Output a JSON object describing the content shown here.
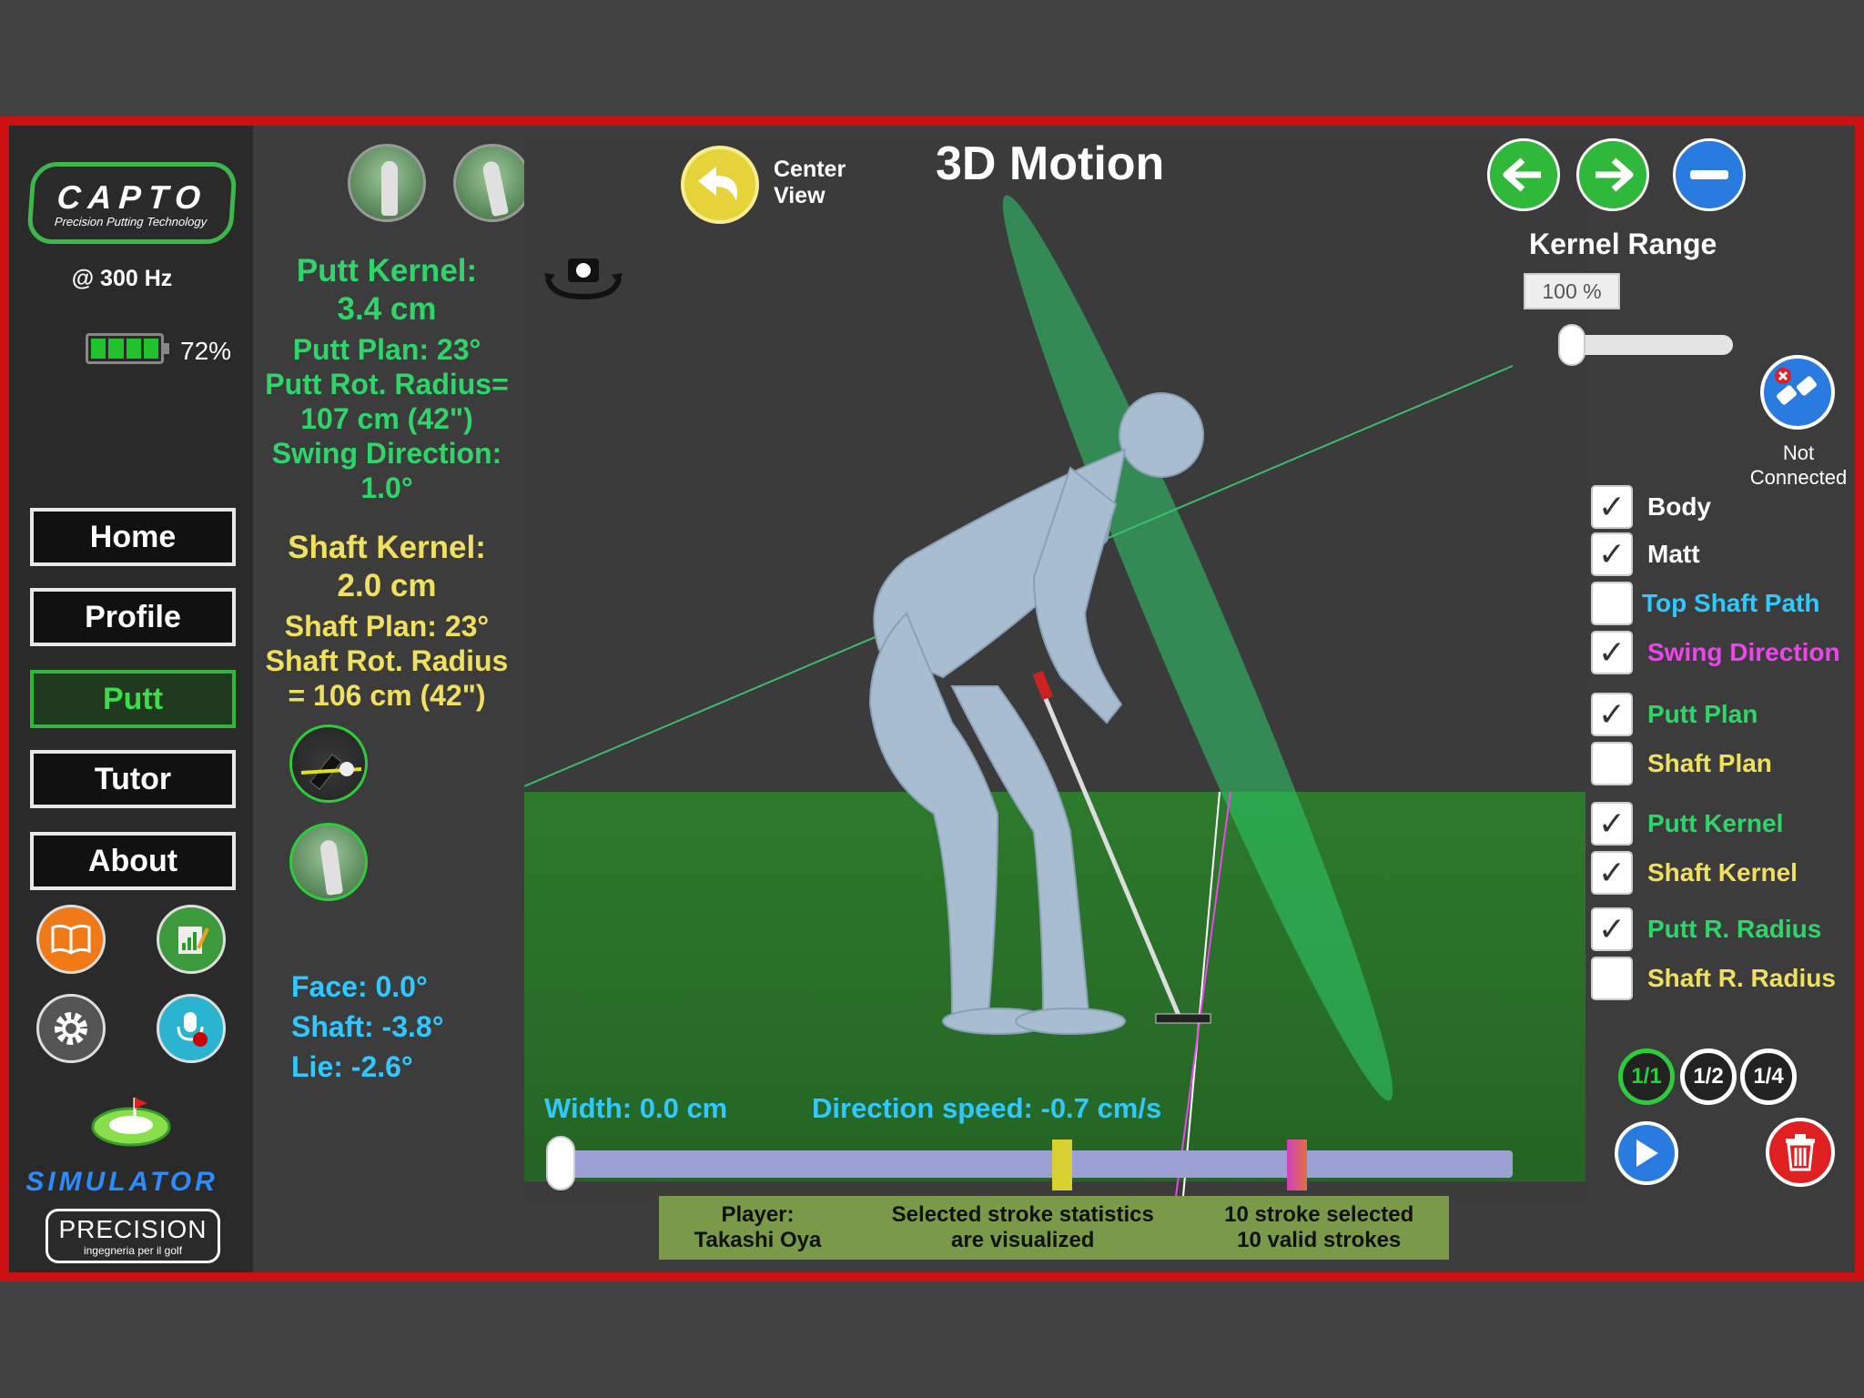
{
  "brand": {
    "logo_text": "CAPTO",
    "logo_sub": "Precision Putting Technology",
    "sample_rate": "@ 300 Hz",
    "battery_pct": "72%",
    "battery_level": 0.72,
    "sim_text": "SIMULATOR",
    "precision_text": "PRECISION",
    "precision_sub": "ingegneria per il golf"
  },
  "nav": {
    "home": "Home",
    "profile": "Profile",
    "putt": "Putt",
    "tutor": "Tutor",
    "about": "About"
  },
  "stats": {
    "putt_kernel_label": "Putt Kernel:",
    "putt_kernel_value": "3.4 cm",
    "putt_plan": "Putt Plan: 23°",
    "putt_rot_radius_label": "Putt Rot. Radius=",
    "putt_rot_radius_value": "107 cm  (42\")",
    "swing_direction_label": "Swing Direction:",
    "swing_direction_value": "1.0°",
    "shaft_kernel_label": "Shaft Kernel:",
    "shaft_kernel_value": "2.0 cm",
    "shaft_plan": "Shaft Plan: 23°",
    "shaft_rot_radius_label": "Shaft Rot. Radius",
    "shaft_rot_radius_value": "= 106 cm  (42\")",
    "face": "Face: 0.0°",
    "shaft": "Shaft: -3.8°",
    "lie": "Lie: -2.6°"
  },
  "viewport": {
    "title": "3D Motion",
    "center_view_line1": "Center",
    "center_view_line2": "View",
    "width_text": "Width: 0.0 cm",
    "direction_speed_text": "Direction speed: -0.7 cm/s"
  },
  "kernel": {
    "label": "Kernel Range",
    "value": "100 %"
  },
  "connection": {
    "line1": "Not",
    "line2": "Connected"
  },
  "toggles": [
    {
      "label": "Body",
      "checked": true
    },
    {
      "label": "Matt",
      "checked": true
    },
    {
      "label": "Top Shaft Path",
      "checked": false
    },
    {
      "label": "Swing Direction",
      "checked": true
    },
    {
      "label": "Putt Plan",
      "checked": true
    },
    {
      "label": "Shaft Plan",
      "checked": false
    },
    {
      "label": "Putt Kernel",
      "checked": true
    },
    {
      "label": "Shaft Kernel",
      "checked": true
    },
    {
      "label": "Putt R. Radius",
      "checked": true
    },
    {
      "label": "Shaft R. Radius",
      "checked": false
    }
  ],
  "speeds": {
    "full": "1/1",
    "half": "1/2",
    "quarter": "1/4"
  },
  "status": {
    "player_label": "Player:",
    "player_name": "Takashi Oya",
    "stats_line1": "Selected stroke statistics",
    "stats_line2": "are visualized",
    "strokes_line1": "10 stroke selected",
    "strokes_line2": "10 valid strokes"
  },
  "colors": {
    "frame": "#cc1111",
    "accent_green": "#2ed66a",
    "accent_yellow": "#f0e060",
    "accent_cyan": "#30c8ff",
    "accent_magenta": "#ee44ee"
  }
}
